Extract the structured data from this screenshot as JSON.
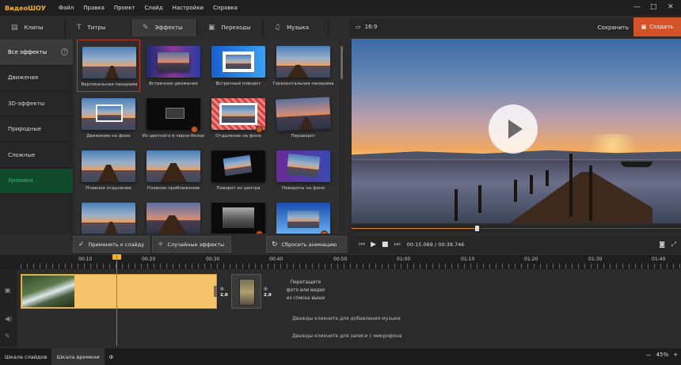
{
  "app": {
    "logo": "ВидеоШОУ"
  },
  "menu": [
    "Файл",
    "Правка",
    "Проект",
    "Слайд",
    "Настройки",
    "Справка"
  ],
  "window_controls": [
    "—",
    "□",
    "✕"
  ],
  "tabs": [
    {
      "label": "Клипы",
      "icon": "film-icon"
    },
    {
      "label": "Титры",
      "icon": "text-icon"
    },
    {
      "label": "Эффекты",
      "icon": "magic-wand-icon"
    },
    {
      "label": "Переходы",
      "icon": "transition-icon"
    },
    {
      "label": "Музыка",
      "icon": "music-icon"
    }
  ],
  "categories": [
    "Все эффекты",
    "Движения",
    "3D-эффекты",
    "Природные",
    "Сложные",
    "Хроники"
  ],
  "effects": [
    "Вертикальная панорама",
    "Встречное движение",
    "Встречный поворот",
    "Горизонтальная панорама",
    "Движение на фоне",
    "Из цветного в черно-белое",
    "Отдаление на фоне",
    "Переворот",
    "Плавное отдаление",
    "Плавное приближение",
    "Поворот из центра",
    "Повороты на фоне"
  ],
  "buttons": {
    "apply": "Применить к слайду",
    "random": "Случайные эффекты",
    "reset": "Сбросить анимацию"
  },
  "preview": {
    "ratio": "16:9",
    "save": "Сохранить",
    "create": "Создать",
    "time_current": "00:15.069",
    "time_total": "00:39.746",
    "progress": 0.38
  },
  "timeline": {
    "ticks": [
      "00:10",
      "00:20",
      "00:30",
      "00:40",
      "00:50",
      "01:00",
      "01:10",
      "01:20",
      "01:30",
      "01:40"
    ],
    "durations": [
      "2.0",
      "2.0"
    ],
    "drop_line1": "Перетащите",
    "drop_line2": "фото или видео",
    "drop_line3": "из списка выше",
    "music_hint": "Дважды кликните для добавления музыки",
    "mic_hint": "Дважды кликните для записи с микрофона"
  },
  "bottom": {
    "slides": "Шкала слайдов",
    "timeline": "Шкала времени",
    "extra": "Ф",
    "zoom": "45%"
  },
  "colors": {
    "accent": "#d4522a",
    "clip": "#f5c36a",
    "green": "#2ec36a",
    "selection": "#c0392b"
  }
}
